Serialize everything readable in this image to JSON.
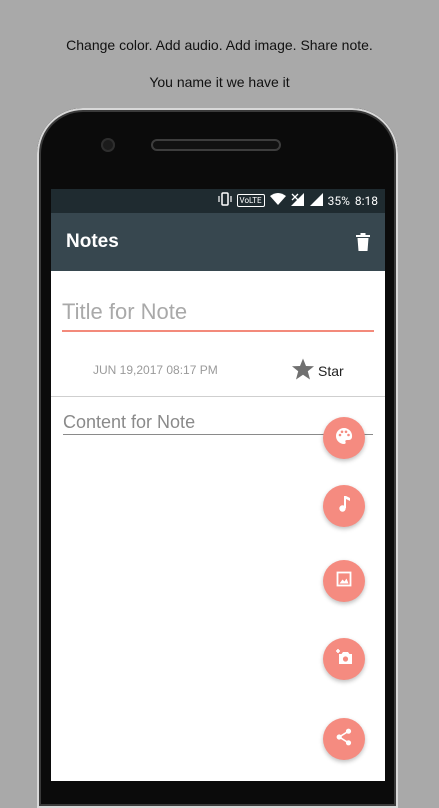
{
  "captions": {
    "line1": "Change color. Add audio. Add image. Share note.",
    "line2": "You name it we have it"
  },
  "status_bar": {
    "volte": "VoLTE",
    "battery": "35%",
    "time": "8:18"
  },
  "toolbar": {
    "title": "Notes",
    "delete_icon": "trash-icon"
  },
  "note": {
    "title_placeholder": "Title for Note",
    "date": "JUN 19,2017  08:17 PM",
    "star_label": "Star",
    "content_placeholder": "Content for Note"
  },
  "fabs": [
    {
      "icon": "palette-icon"
    },
    {
      "icon": "music-note-icon"
    },
    {
      "icon": "image-icon"
    },
    {
      "icon": "camera-add-icon"
    },
    {
      "icon": "share-icon"
    }
  ],
  "colors": {
    "background": "#a9a9a9",
    "toolbar": "#37474f",
    "status_bar": "#1f2b30",
    "accent": "#f58b80",
    "star": "#707070"
  }
}
